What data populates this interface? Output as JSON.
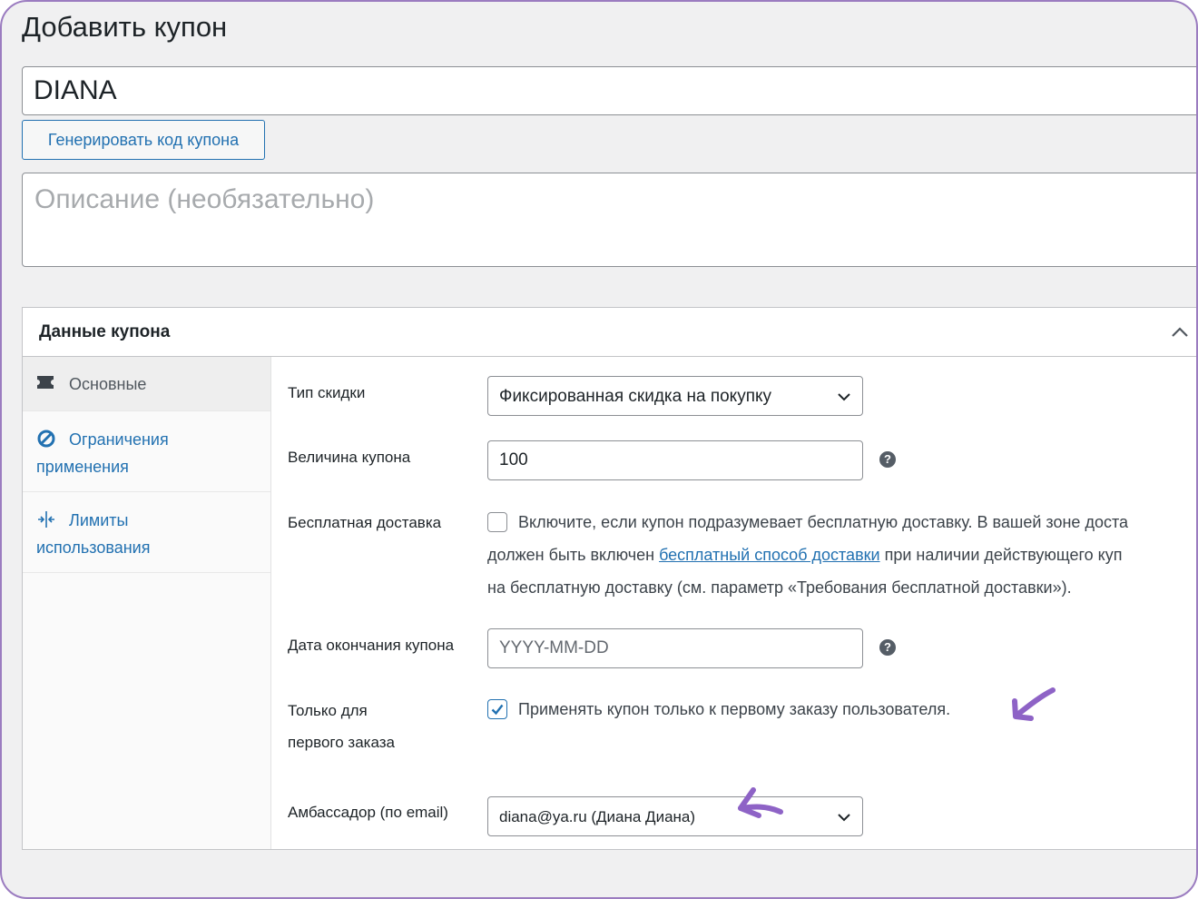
{
  "page": {
    "title": "Добавить купон",
    "coupon_code": "DIANA",
    "generate_button": "Генерировать код купона",
    "description_placeholder": "Описание (необязательно)"
  },
  "panel": {
    "title": "Данные купона",
    "tabs": [
      {
        "label": "Основные",
        "icon": "ticket-icon"
      },
      {
        "label_line1": "Ограничения",
        "label_line2": "применения",
        "icon": "no-entry-icon"
      },
      {
        "label_line1": "Лимиты",
        "label_line2": "использования",
        "icon": "limits-icon"
      }
    ]
  },
  "fields": {
    "discount_type": {
      "label": "Тип скидки",
      "value": "Фиксированная скидка на покупку"
    },
    "coupon_amount": {
      "label": "Величина купона",
      "value": "100",
      "help": "?"
    },
    "free_shipping": {
      "label": "Бесплатная доставка",
      "checked": false,
      "line1": "Включите, если купон подразумевает бесплатную доставку. В вашей зоне доста",
      "line2_before": "должен быть включен ",
      "line2_link": "бесплатный способ доставки",
      "line2_after": " при наличии действующего куп",
      "line3": "на бесплатную доставку (см. параметр «Требования бесплатной доставки»)."
    },
    "expiry_date": {
      "label": "Дата окончания купона",
      "placeholder": "YYYY-MM-DD",
      "help": "?"
    },
    "first_order": {
      "label_line1": "Только для",
      "label_line2": "первого заказа",
      "checked": true,
      "text": "Применять купон только к первому заказу пользователя."
    },
    "ambassador": {
      "label": "Амбассадор (по email)",
      "value": "diana@ya.ru (Диана Диана)"
    }
  },
  "colors": {
    "accent": "#2271b1",
    "annotation_arrow": "#8e63c6",
    "frame_border": "#9b7cc0"
  }
}
